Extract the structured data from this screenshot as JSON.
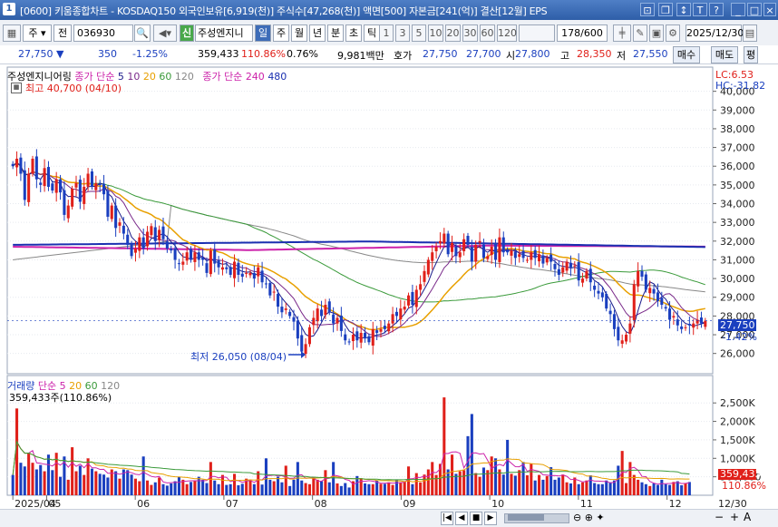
{
  "window": {
    "number": "1",
    "title": "[0600] 키움종합차트 - KOSDAQ150 외국인보유[6,919(천)] 주식수[47,268(천)] 액면[500] 자본금[241(억)] 결산[12월] EPS"
  },
  "toolbar": {
    "mode_label": "주",
    "prev_label": "전",
    "code": "036930",
    "sin_label": "신",
    "stock_name": "주성엔지니",
    "period_tabs": [
      "일",
      "주",
      "월",
      "년",
      "분",
      "초",
      "틱"
    ],
    "active_period": "일",
    "intervals": [
      "1",
      "3",
      "5",
      "10",
      "20",
      "30",
      "60",
      "120"
    ],
    "count": "178/600",
    "date": "2025/12/30",
    "sell_label": "매수",
    "buy_label": "매도",
    "eval_label": "평"
  },
  "quote": {
    "price": "27,750",
    "change": "350",
    "change_pct": "-1.25%",
    "volume": "359,433",
    "vol_ratio": "110.86%",
    "turnover": "0.76%",
    "amount": "9,981백만",
    "ask_label": "호가",
    "ask": "27,750",
    "bid": "27,700",
    "open_label": "시",
    "open": "27,800",
    "high_label": "고",
    "high": "28,350",
    "low_label": "저",
    "low": "27,550"
  },
  "price_panel": {
    "name": "주성엔지니어링",
    "ma_label": "종가 단순",
    "ma_periods": [
      "5",
      "10",
      "20",
      "60",
      "120"
    ],
    "ma2_label": "종가 단순",
    "ma2_periods": [
      "240",
      "480"
    ],
    "lc": "LC:6.53",
    "hc": "HC:-31.82",
    "max_label": "최고 40,700 (04/10)",
    "min_label": "최저 26,050 (08/04)",
    "current_price": "27,750",
    "current_pct": "-1.42%",
    "y_ticks": [
      "40,000",
      "39,000",
      "38,000",
      "37,000",
      "36,000",
      "35,000",
      "34,000",
      "33,000",
      "32,000",
      "31,000",
      "30,000",
      "29,000",
      "28,000",
      "27,000",
      "26,000"
    ]
  },
  "volume_panel": {
    "name": "거래량",
    "ma_label": "단순",
    "ma_periods": [
      "5",
      "20",
      "60",
      "120"
    ],
    "current": "359,433주(110.86%)",
    "y_ticks": [
      "2,500K",
      "2,000K",
      "1,500K",
      "1,000K",
      "500,000"
    ],
    "current_box": "359,433",
    "current_pct": "110.86%"
  },
  "x_axis": {
    "labels": [
      "2025/04",
      "05",
      "06",
      "07",
      "08",
      "09",
      "10",
      "11",
      "12",
      "12/30"
    ]
  },
  "colors": {
    "up": "#e0201a",
    "down": "#1a3fbf",
    "ma5": "#1a1a8a",
    "ma10": "#7a2a8a",
    "ma20": "#e8a000",
    "ma60": "#3a9a3a",
    "ma120": "#888888",
    "ma240": "#cc22aa",
    "ma480": "#1a2fb0"
  },
  "chart_data": {
    "type": "candlestick",
    "ylim": [
      25500,
      41000
    ],
    "closes": [
      36000,
      36400,
      35600,
      34200,
      35600,
      36400,
      35300,
      35000,
      35900,
      34900,
      34700,
      35300,
      34600,
      33400,
      33900,
      34800,
      35100,
      34100,
      34900,
      35600,
      34900,
      35100,
      35000,
      34500,
      33300,
      33900,
      32700,
      33000,
      32400,
      31800,
      31200,
      31600,
      32200,
      31600,
      32500,
      32800,
      32000,
      32600,
      32100,
      31600,
      31500,
      31000,
      30800,
      30900,
      31400,
      31000,
      31400,
      31000,
      31000,
      30300,
      31500,
      30800,
      30600,
      30600,
      30500,
      30200,
      30900,
      30200,
      30100,
      30300,
      30300,
      30000,
      30600,
      29800,
      29700,
      29100,
      29300,
      28500,
      28200,
      28400,
      28000,
      27700,
      26800,
      26100,
      26500,
      27400,
      27900,
      28400,
      28000,
      28600,
      28200,
      27600,
      27900,
      27200,
      26700,
      26600,
      27000,
      26700,
      27100,
      26800,
      26600,
      27300,
      27100,
      27300,
      27300,
      27600,
      28100,
      28000,
      28400,
      28500,
      29100,
      28600,
      29400,
      29700,
      30400,
      31000,
      31400,
      31700,
      32000,
      32400,
      31300,
      31900,
      31200,
      31400,
      32100,
      31800,
      30900,
      31800,
      32000,
      31100,
      31200,
      31700,
      31000,
      32200,
      31400,
      31400,
      31500,
      31100,
      31300,
      31100,
      31000,
      31400,
      31100,
      31300,
      30800,
      31100,
      30900,
      30500,
      30200,
      30600,
      30900,
      30600,
      30700,
      29900,
      30000,
      30400,
      29800,
      29400,
      29200,
      29000,
      28400,
      28100,
      27300,
      26700,
      26700,
      27000,
      27600,
      29700,
      30400,
      30100,
      29400,
      29500,
      29200,
      28800,
      28600,
      28400,
      27800,
      28000,
      27500,
      27300,
      27400,
      27500,
      27600,
      27800,
      27600,
      27750
    ],
    "volumes_k": [
      550,
      2350,
      880,
      780,
      1150,
      880,
      700,
      820,
      650,
      1100,
      680,
      1150,
      500,
      1050,
      420,
      1300,
      650,
      800,
      550,
      1000,
      720,
      650,
      580,
      560,
      480,
      700,
      650,
      450,
      700,
      680,
      560,
      450,
      380,
      1050,
      400,
      280,
      350,
      480,
      300,
      260,
      320,
      380,
      500,
      420,
      300,
      360,
      380,
      500,
      420,
      330,
      900,
      400,
      300,
      550,
      280,
      300,
      580,
      270,
      310,
      450,
      400,
      300,
      650,
      290,
      1000,
      420,
      380,
      500,
      350,
      800,
      250,
      420,
      900,
      400,
      330,
      300,
      470,
      420,
      380,
      680,
      350,
      900,
      320,
      250,
      330,
      210,
      380,
      520,
      460,
      320,
      300,
      300,
      400,
      310,
      310,
      350,
      280,
      420,
      350,
      380,
      780,
      300,
      600,
      350,
      560,
      700,
      900,
      550,
      850,
      2650,
      700,
      1100,
      580,
      650,
      680,
      1600,
      2200,
      600,
      500,
      750,
      680,
      1050,
      1000,
      700,
      560,
      1500,
      580,
      530,
      680,
      900,
      540,
      850,
      400,
      550,
      420,
      520,
      760,
      420,
      480,
      560,
      350,
      320,
      480,
      300,
      350,
      400,
      540,
      330,
      300,
      300,
      400,
      350,
      400,
      800,
      1200,
      330,
      900,
      550,
      420,
      350,
      300,
      250,
      320,
      280,
      420,
      300,
      280,
      360,
      380,
      270,
      320,
      359
    ]
  }
}
